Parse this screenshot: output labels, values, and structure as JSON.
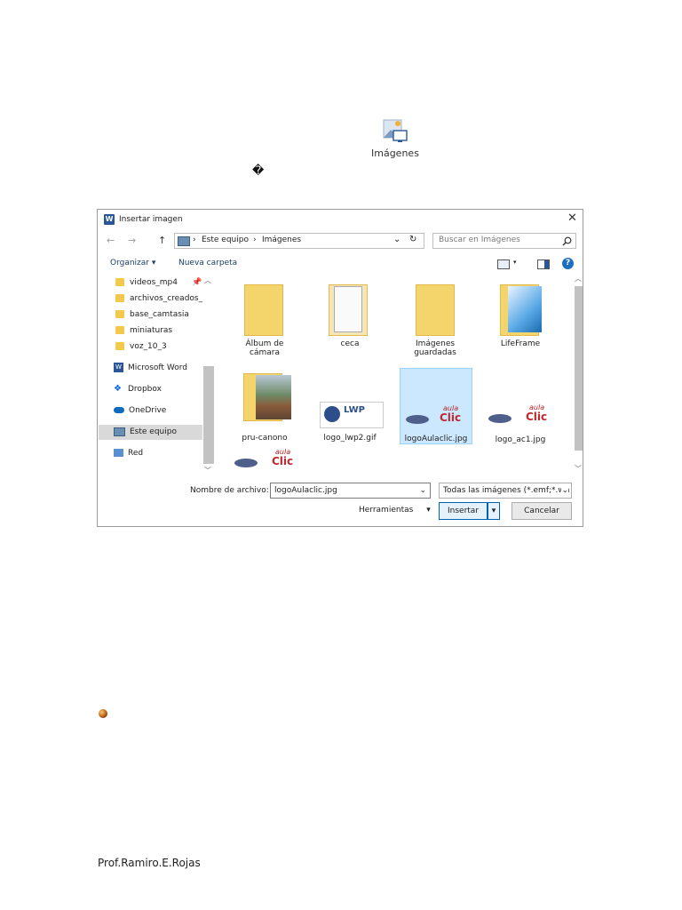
{
  "header_icon": {
    "label": "Imágenes",
    "icon": "images-icon"
  },
  "glyph": "�",
  "dialog": {
    "title": "Insertar imagen",
    "app_icon": "word-icon",
    "close": "✕",
    "nav": {
      "back": "←",
      "forward": "→",
      "up": "↑"
    },
    "path": {
      "segments": [
        "Este equipo",
        "Imágenes"
      ],
      "sep": "›"
    },
    "refresh": "↻",
    "search_placeholder": "Buscar en Imágenes",
    "toolbar": {
      "organize": "Organizar",
      "new_folder": "Nueva carpeta",
      "help": "?"
    },
    "sidebar": {
      "folders": [
        "videos_mp4",
        "archivos_creados_",
        "base_camtasia",
        "miniaturas",
        "voz_10_3"
      ],
      "locations": [
        {
          "label": "Microsoft Word",
          "icon": "word-icon"
        },
        {
          "label": "Dropbox",
          "icon": "dropbox-icon"
        },
        {
          "label": "OneDrive",
          "icon": "onedrive-icon"
        },
        {
          "label": "Este equipo",
          "icon": "computer-icon"
        },
        {
          "label": "Red",
          "icon": "network-icon"
        }
      ]
    },
    "files": {
      "album_label": "Álbum de cámara",
      "ceca": "ceca",
      "guardadas_label": "Imágenes guardadas",
      "lifeframe": "LifeFrame",
      "pru_canono": "pru-canono",
      "logo_lwp2": "logo_lwp2.gif",
      "logo_aulaclic": "logoAulaclic.jpg",
      "logo_ac1": "logo_ac1.jpg"
    },
    "lwp_text": "LWP",
    "aula_text": "aula",
    "clic_text": "Clic",
    "filename_label": "Nombre de archivo:",
    "filename_value": "logoAulaclic.jpg",
    "filter_value": "Todas las imágenes (*.emf;*.wn",
    "tools_label": "Herramientas",
    "insert_label": "Insertar",
    "cancel_label": "Cancelar",
    "colors": {
      "selected": "#cce8ff",
      "accent": "#0063b1"
    }
  },
  "footer": "Prof.Ramiro.E.Rojas"
}
